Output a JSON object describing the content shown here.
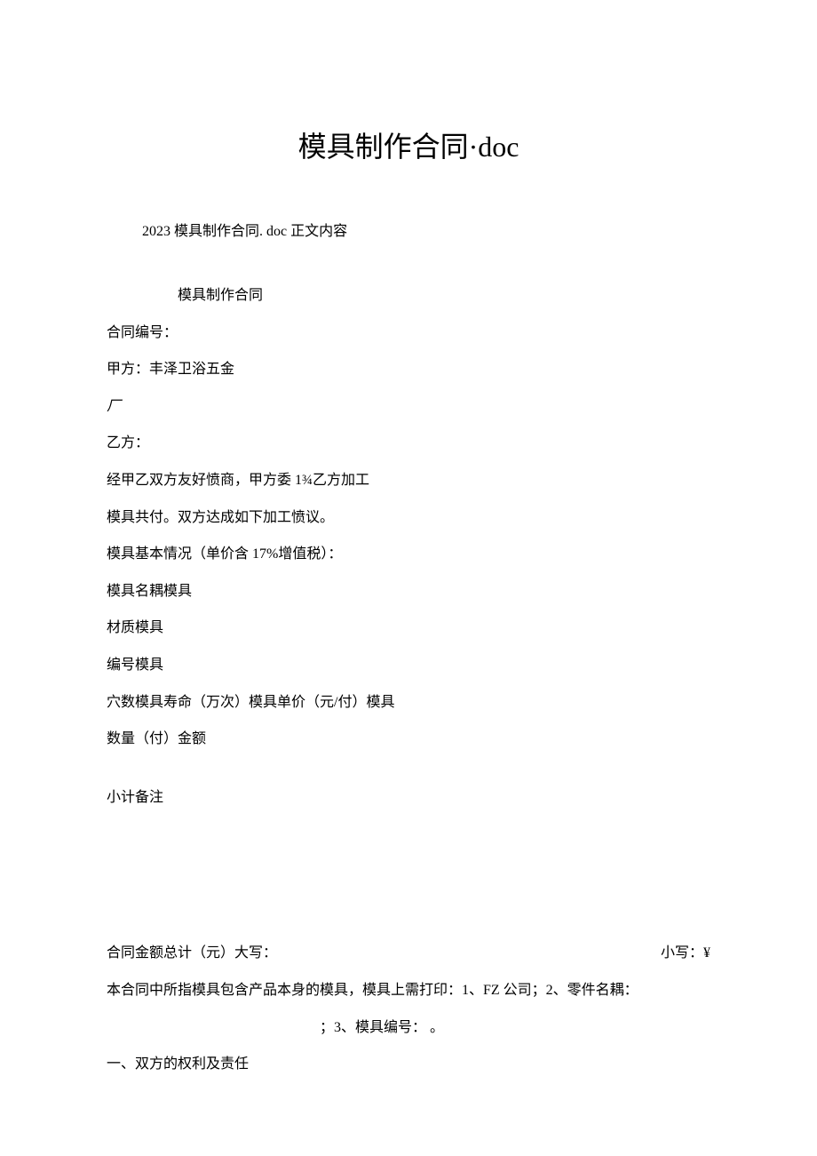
{
  "title": "模具制作合同·doc",
  "subtitle": "2023 模具制作合同. doc 正文内容",
  "heading": "模具制作合同",
  "lines": {
    "contract_no": "合同编号：",
    "party_a": "甲方：丰泽卫浴五金",
    "factory": "厂",
    "party_b": "乙方：",
    "nego": "经甲乙双方友好愤商，甲方委 1¾乙方加工",
    "molds_total": "模具共付。双方达成如下加工愤议。",
    "basic_info": "模具基本情况（单价含 17%增值税）：",
    "mold_name": "模具名耦模具",
    "material": "材质模具",
    "number": "编号模具",
    "cavity": "穴数模具寿命（万次）模具单价（元/付）模具",
    "qty": "数量（付）金额",
    "subtotal": "小计备注",
    "total_left": "合同金额总计（元）大写：",
    "total_right": "小写：¥",
    "scope": "本合同中所指模具包含产品本身的模具，模具上需打印：1、FZ 公司；2、零件名耦：",
    "scope2": "；3、模具编号：                            。",
    "section1": "一、双方的权利及责任"
  }
}
